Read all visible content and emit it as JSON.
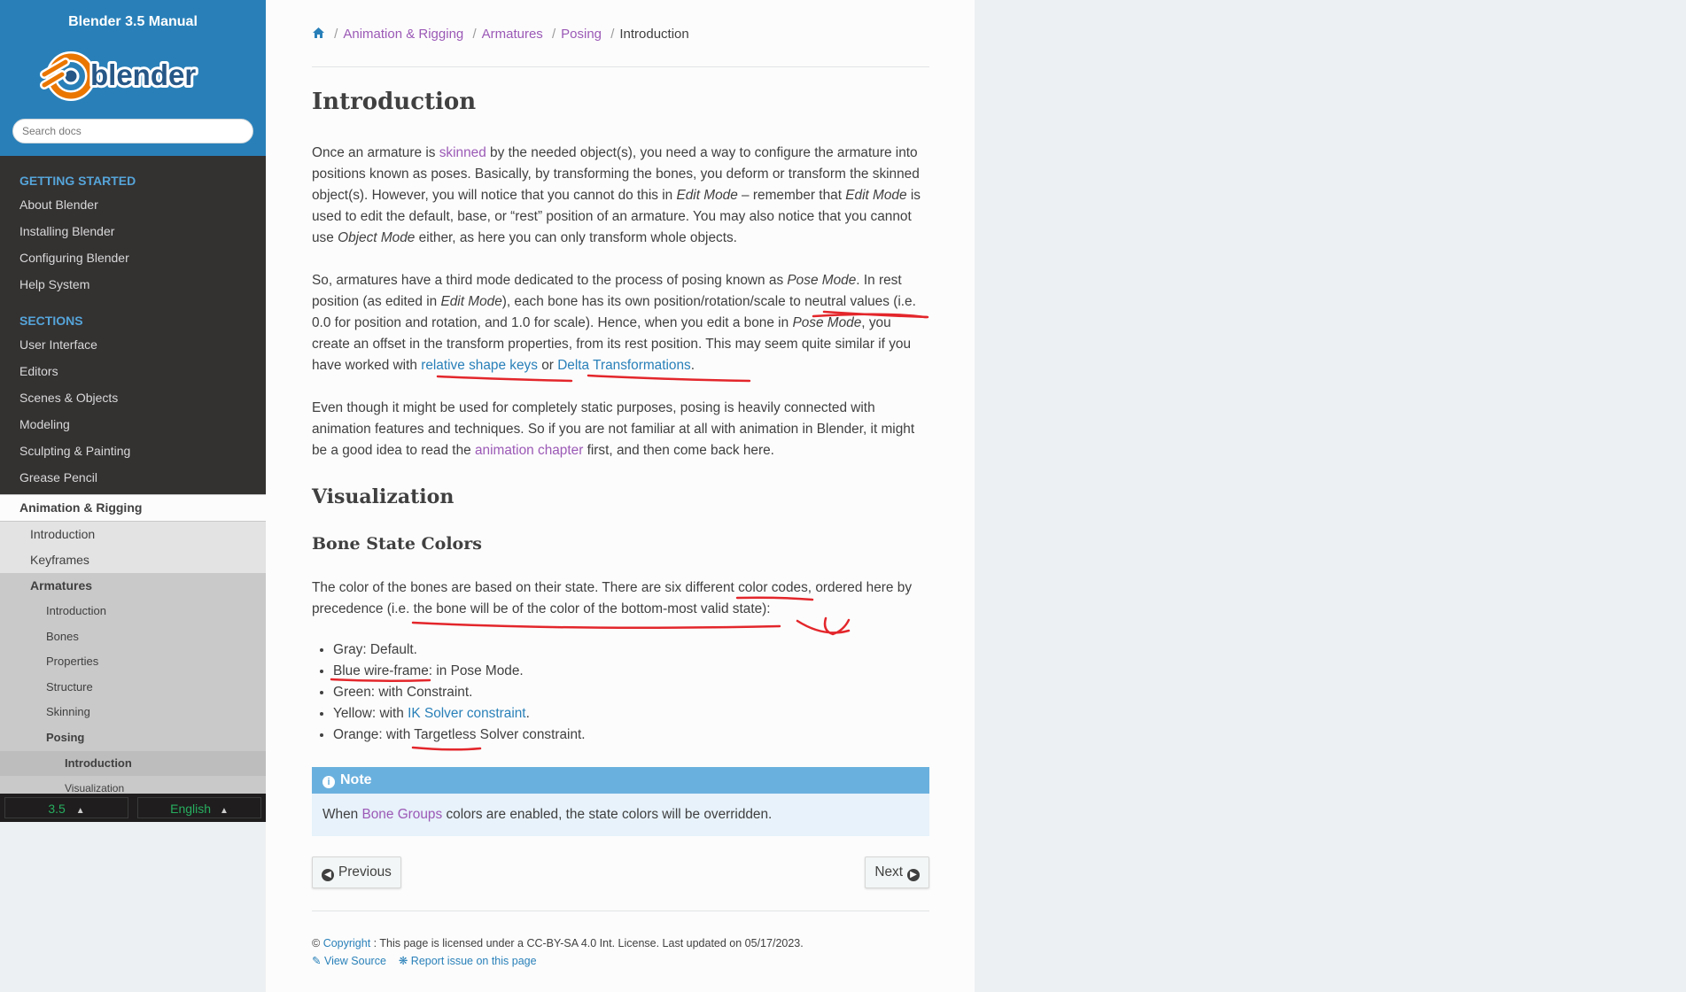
{
  "sidebar": {
    "title": "Blender 3.5 Manual",
    "logo_text": "blender",
    "search_placeholder": "Search docs",
    "captions": [
      "GETTING STARTED",
      "SECTIONS"
    ],
    "getting_started": [
      "About Blender",
      "Installing Blender",
      "Configuring Blender",
      "Help System"
    ],
    "sections": [
      "User Interface",
      "Editors",
      "Scenes & Objects",
      "Modeling",
      "Sculpting & Painting",
      "Grease Pencil"
    ],
    "current_section": "Animation & Rigging",
    "level2": [
      "Introduction",
      "Keyframes",
      "Armatures"
    ],
    "level3": [
      "Introduction",
      "Bones",
      "Properties",
      "Structure",
      "Skinning",
      "Posing"
    ],
    "level4": [
      "Introduction",
      "Visualization"
    ],
    "version": "3.5",
    "language": "English"
  },
  "breadcrumb": [
    "Animation & Rigging",
    "Armatures",
    "Posing",
    "Introduction"
  ],
  "page": {
    "title": "Introduction",
    "p1": {
      "a": "Once an armature is ",
      "link": "skinned",
      "b": " by the needed object(s), you need a way to configure the armature into positions known as poses. Basically, by transforming the bones, you deform or transform the skinned object(s). However, you will notice that you cannot do this in ",
      "em1": "Edit Mode",
      "c": " – remember that ",
      "em2": "Edit Mode",
      "d": " is used to edit the default, base, or “rest” position of an armature. You may also notice that you cannot use ",
      "em3": "Object Mode",
      "e": " either, as here you can only transform whole objects."
    },
    "p2": {
      "a": "So, armatures have a third mode dedicated to the process of posing known as ",
      "em1": "Pose Mode",
      "b": ". In rest position (as edited in ",
      "em2": "Edit Mode",
      "c": "), each bone has its own position/rotation/scale to neutral values (i.e. 0.0 for position and rotation, and 1.0 for scale). Hence, when you edit a bone in ",
      "em3": "Pose Mode",
      "d": ", you create an offset in the transform properties, from its rest position. This may seem quite similar if you have worked with ",
      "link1": "relative shape keys",
      "e": " or ",
      "link2": "Delta Transformations",
      "f": "."
    },
    "p3": {
      "a": "Even though it might be used for completely static purposes, posing is heavily connected with animation features and techniques. So if you are not familiar at all with animation in Blender, it might be a good idea to read the ",
      "link": "animation chapter",
      "b": " first, and then come back here."
    },
    "h2": "Visualization",
    "h3": "Bone State Colors",
    "p4": "The color of the bones are based on their state. There are six different color codes, ordered here by precedence (i.e. the bone will be of the color of the bottom-most valid state):",
    "list": [
      {
        "text": "Gray: Default."
      },
      {
        "text": "Blue wire-frame: in Pose Mode."
      },
      {
        "text": "Green: with Constraint."
      },
      {
        "pre": "Yellow: with ",
        "link": "IK Solver constraint",
        "post": "."
      },
      {
        "text": "Orange: with Targetless Solver constraint."
      }
    ],
    "note": {
      "title": "Note",
      "a": "When ",
      "link": "Bone Groups",
      "b": " colors are enabled, the state colors will be overridden."
    },
    "prev_label": "Previous",
    "next_label": "Next",
    "footer": {
      "copyright_link": "Copyright",
      "license": ": This page is licensed under a CC-BY-SA 4.0 Int. License. Last updated on 05/17/2023.",
      "view_source": "View Source",
      "report_issue": "Report issue on this page"
    }
  },
  "colors": {
    "sidebar_bg": "#343131",
    "header_bg": "#2980b9",
    "link": "#2980b9",
    "visited_link": "#9b59b6",
    "note_head": "#6ab0de",
    "note_bg": "#e7f2fa",
    "annotation": "#e3262b"
  }
}
